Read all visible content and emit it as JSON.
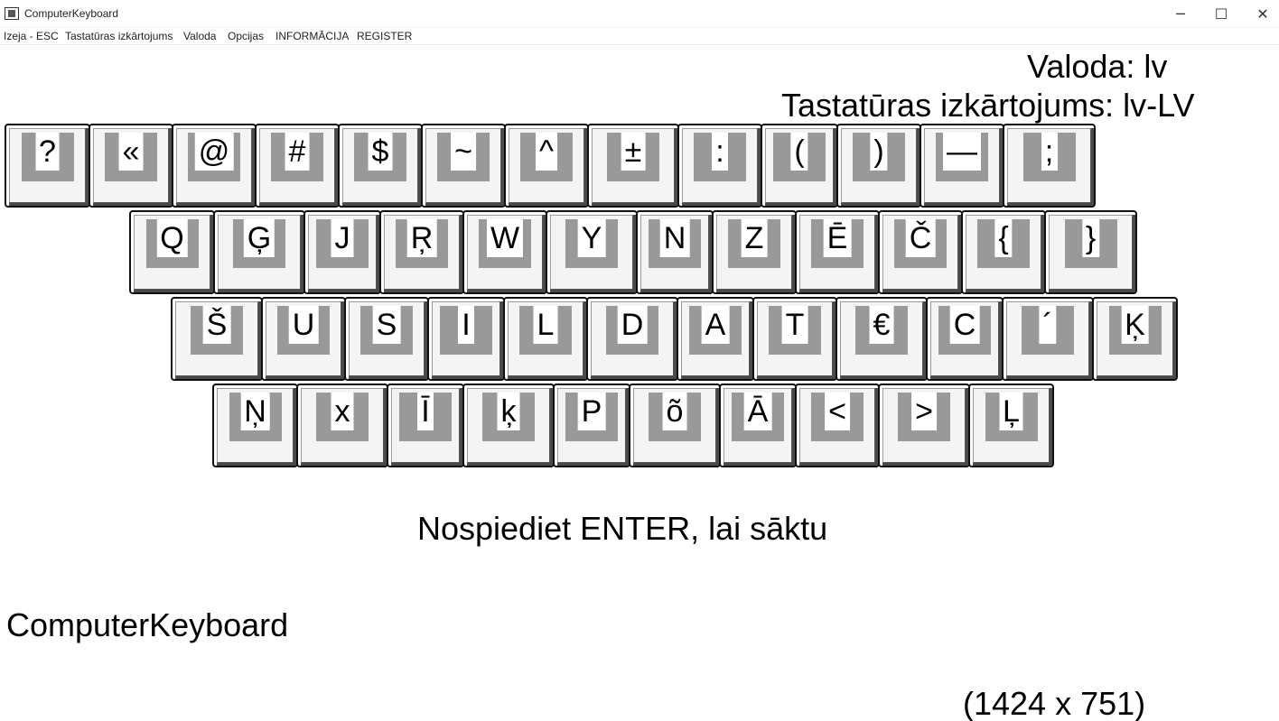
{
  "window": {
    "title": "ComputerKeyboard",
    "minimize": "─",
    "maximize": "☐",
    "close": "✕"
  },
  "menu": [
    "Izeja - ESC",
    "Tastatūras izkārtojums",
    "Valoda",
    "Opcijas",
    "INFORMĀCIJA",
    "REGISTER"
  ],
  "info": {
    "language": "Valoda: lv",
    "layout": "Tastatūras izkārtojums: lv-LV"
  },
  "keyboard": {
    "rows": [
      [
        "?",
        "«",
        "@",
        "#",
        "$",
        "~",
        "^",
        "±",
        ":",
        "(",
        ")",
        "—",
        ";"
      ],
      [
        "Q",
        "Ģ",
        "J",
        "Ŗ",
        "W",
        "Y",
        "N",
        "Z",
        "Ē",
        "Č",
        "{",
        "}"
      ],
      [
        "Š",
        "U",
        "S",
        "I",
        "L",
        "D",
        "A",
        "T",
        "€",
        "C",
        "´",
        "Ķ"
      ],
      [
        "Ņ",
        "x",
        "Ī",
        "ķ",
        "P",
        "õ",
        "Ā",
        "<",
        ">",
        "Ļ"
      ]
    ]
  },
  "prompt": "Nospiediet ENTER, lai sāktu",
  "app_name": "ComputerKeyboard",
  "resolution": "(1424 x 751)"
}
